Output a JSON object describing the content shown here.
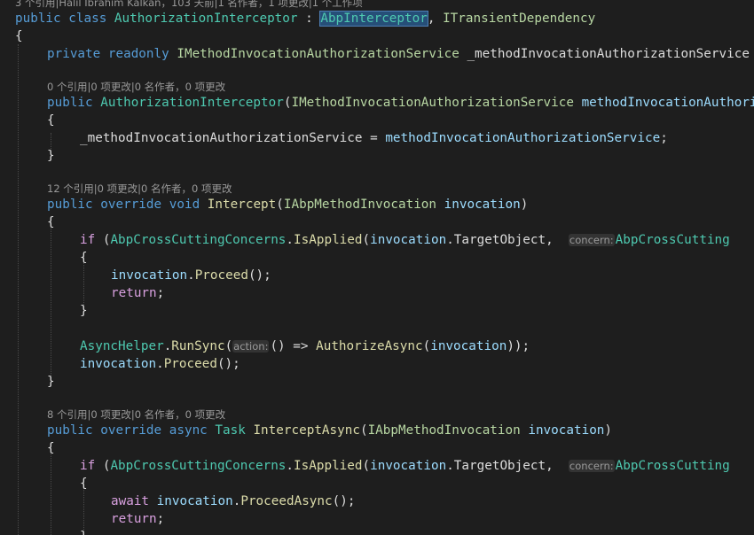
{
  "code_lens": {
    "class_header": "3 个引用|Halil İbrahim Kalkan，103 天前|1 名作者，1 项更改|1 个工作项",
    "constructor": "0 个引用|0 项更改|0 名作者，0 项更改",
    "intercept": "12 个引用|0 项更改|0 名作者，0 项更改",
    "intercept_async": "8 个引用|0 项更改|0 名作者，0 项更改"
  },
  "tokens": {
    "kw_public": "public",
    "kw_class": "class",
    "kw_private": "private",
    "kw_readonly": "readonly",
    "kw_override": "override",
    "kw_void": "void",
    "kw_async": "async",
    "kw_if": "if",
    "kw_return": "return",
    "kw_await": "await",
    "class_name": "AuthorizationInterceptor",
    "base_class": "AbpInterceptor",
    "interface_transient": "ITransientDependency",
    "service_interface": "IMethodInvocationAuthorizationService",
    "field_name": "_methodInvocationAuthorizationService",
    "ctor_param": "methodInvocationAuthorizationService",
    "invocation_type": "IAbpMethodInvocation",
    "param_invocation": "invocation",
    "method_intercept": "Intercept",
    "method_intercept_async": "InterceptAsync",
    "type_task": "Task",
    "class_concerns": "AbpCrossCuttingConcerns",
    "method_is_applied": "IsApplied",
    "prop_target_object": "TargetObject",
    "hint_concern": "concern:",
    "concern_truncated": "AbpCrossCutting",
    "method_proceed": "Proceed",
    "method_proceed_async": "ProceedAsync",
    "class_async_helper": "AsyncHelper",
    "method_run_sync": "RunSync",
    "hint_action": "action:",
    "method_authorize_async": "AuthorizeAsync"
  },
  "colors": {
    "background": "#1e1e1e",
    "keyword": "#569cd6",
    "control_keyword": "#d8a0df",
    "type": "#4ec9b0",
    "interface": "#b8d7a3",
    "method": "#dcdcaa",
    "parameter": "#9cdcfe",
    "selection": "#264f78"
  }
}
